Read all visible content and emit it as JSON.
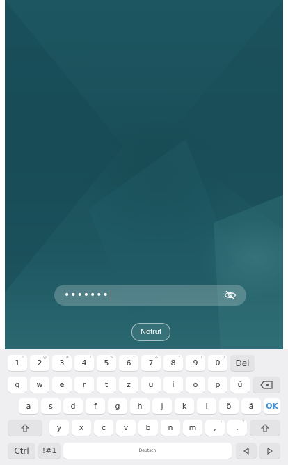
{
  "lockscreen": {
    "password_masked": "•••••••",
    "emergency_label": "Notruf"
  },
  "keyboard": {
    "row1": [
      {
        "label": "1",
        "hint": "~"
      },
      {
        "label": "2",
        "hint": "@"
      },
      {
        "label": "3",
        "hint": "#"
      },
      {
        "label": "4",
        "hint": "/"
      },
      {
        "label": "5",
        "hint": "%"
      },
      {
        "label": "6",
        "hint": "^"
      },
      {
        "label": "7",
        "hint": "&"
      },
      {
        "label": "8",
        "hint": "*"
      },
      {
        "label": "9",
        "hint": "("
      },
      {
        "label": "0",
        "hint": ")"
      }
    ],
    "del_label": "Del",
    "row2": [
      "q",
      "w",
      "e",
      "r",
      "t",
      "z",
      "u",
      "i",
      "o",
      "p",
      "ü"
    ],
    "row3": [
      "a",
      "s",
      "d",
      "f",
      "g",
      "h",
      "j",
      "k",
      "l",
      "ö",
      "ä"
    ],
    "ok_label": "OK",
    "row4": [
      "y",
      "x",
      "c",
      "v",
      "b",
      "n",
      "m"
    ],
    "row4_punct": [
      {
        "label": ",",
        "hint": "!"
      },
      {
        "label": ".",
        "hint": "?"
      }
    ],
    "ctrl_label": "Ctrl",
    "symbols_label": "!#1",
    "space_label": "Deutsch"
  },
  "colors": {
    "wallpaper": "#1d5661",
    "ok_accent": "#3b8fd6",
    "keyboard_bg": "#efeff1"
  },
  "icons": [
    "eye-slash-icon",
    "backspace-icon",
    "shift-icon",
    "arrow-left-icon",
    "arrow-right-icon"
  ]
}
